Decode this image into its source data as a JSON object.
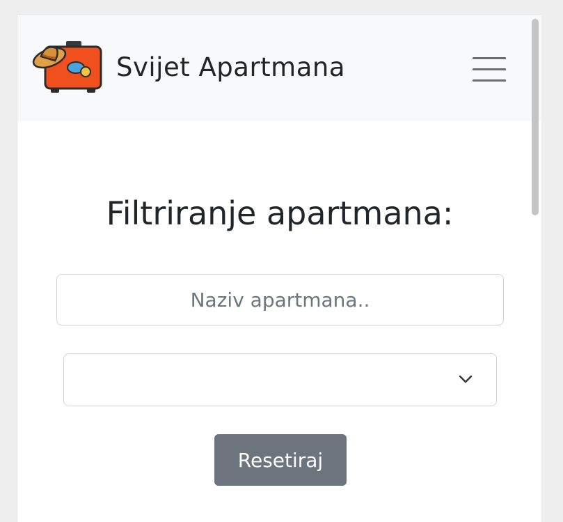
{
  "navbar": {
    "brand": "Svijet Apartmana",
    "logo_icon": "suitcase-hat-icon",
    "menu_icon": "hamburger-menu-icon"
  },
  "filter": {
    "title": "Filtriranje apartmana:",
    "name_input": {
      "value": "",
      "placeholder": "Naziv apartmana.."
    },
    "select": {
      "selected": "",
      "icon": "chevron-down-icon"
    },
    "reset_label": "Resetiraj"
  },
  "colors": {
    "navbar_bg": "#f8f9fa",
    "button_secondary": "#6c757d",
    "suitcase": "#f0501e",
    "hat": "#d9903a"
  }
}
